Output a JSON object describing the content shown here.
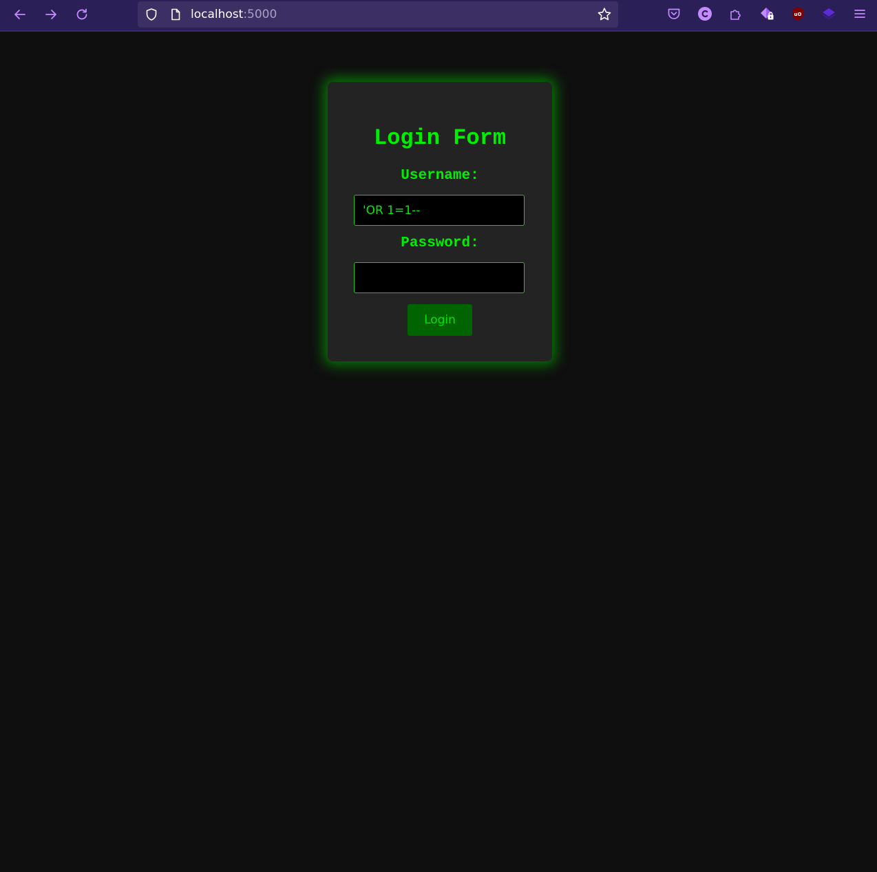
{
  "browser": {
    "url_host": "localhost",
    "url_port": ":5000",
    "accent_color": "#c48bff"
  },
  "login_form": {
    "title": "Login Form",
    "username_label": "Username:",
    "username_value": "'OR 1=1--",
    "password_label": "Password:",
    "password_value": "",
    "login_button": "Login",
    "accent_color": "#00ee00",
    "button_color": "#006400"
  }
}
